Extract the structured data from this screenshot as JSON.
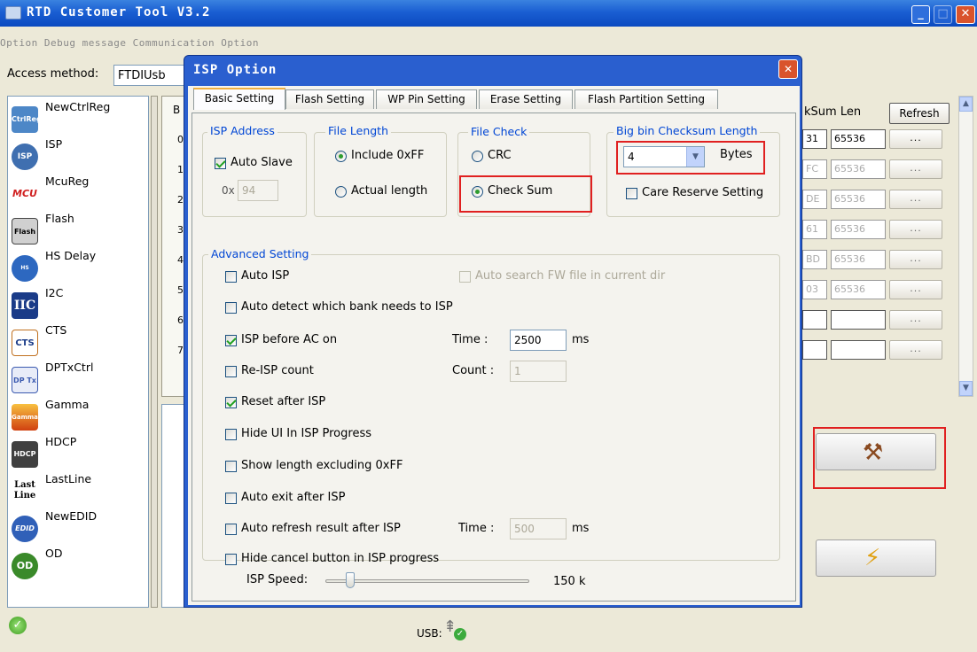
{
  "window": {
    "title": "RTD Customer Tool V3.2"
  },
  "menu": {
    "label": "Option  Debug message  Communication Option"
  },
  "access": {
    "label": "Access method:",
    "value": "FTDIUsb"
  },
  "sidebar": {
    "items": [
      {
        "label": "NewCtrlReg",
        "icon": "ctrlreg-icon",
        "badge": "CtrlReg",
        "color": "#4d87c7"
      },
      {
        "label": "ISP",
        "icon": "isp-icon",
        "badge": "ISP",
        "color": "#3f6fb0"
      },
      {
        "label": "McuReg",
        "icon": "mcu-icon",
        "badge": "MCU",
        "color": "#d02020"
      },
      {
        "label": "Flash",
        "icon": "flash-icon",
        "badge": "Flash",
        "color": "#707070"
      },
      {
        "label": "HS Delay",
        "icon": "hs-delay-icon",
        "badge": "HS Delay",
        "color": "#2d68c0"
      },
      {
        "label": "I2C",
        "icon": "i2c-icon",
        "badge": "IIC",
        "color": "#1a3b88"
      },
      {
        "label": "CTS",
        "icon": "cts-icon",
        "badge": "CTS",
        "color": "#c07020"
      },
      {
        "label": "DPTxCtrl",
        "icon": "dptx-icon",
        "badge": "DP Tx",
        "color": "#3b5ab0"
      },
      {
        "label": "Gamma",
        "icon": "gamma-icon",
        "badge": "Gamma",
        "color": "#e07018"
      },
      {
        "label": "HDCP",
        "icon": "hdcp-icon",
        "badge": "HDCP",
        "color": "#404040"
      },
      {
        "label": "LastLine",
        "icon": "lastline-icon",
        "badge": "Last Line",
        "color": "#000000"
      },
      {
        "label": "NewEDID",
        "icon": "edid-icon",
        "badge": "EDID",
        "color": "#3060b8"
      },
      {
        "label": "OD",
        "icon": "od-icon",
        "badge": "OD",
        "color": "#3a8a2a"
      }
    ]
  },
  "table": {
    "col_b": "B",
    "rows": [
      "0",
      "1",
      "2",
      "3",
      "4",
      "5",
      "6",
      "7"
    ],
    "col_checksum": "kSum Len",
    "refresh": "Refresh",
    "checks": [
      "31",
      "FC",
      "DE",
      "61",
      "BD",
      "03",
      "",
      ""
    ],
    "lens": [
      "65536",
      "65536",
      "65536",
      "65536",
      "65536",
      "65536",
      "",
      ""
    ],
    "dots": "..."
  },
  "status": {
    "usb_label": "USB:"
  },
  "dialog": {
    "title": "ISP Option",
    "tabs": [
      "Basic Setting",
      "Flash Setting",
      "WP Pin Setting",
      "Erase Setting",
      "Flash Partition Setting"
    ],
    "isp_address": {
      "group": "ISP Address",
      "auto_slave": "Auto Slave",
      "prefix": "0x",
      "address": "94"
    },
    "file_length": {
      "group": "File Length",
      "include": "Include 0xFF",
      "actual": "Actual length"
    },
    "file_check": {
      "group": "File Check",
      "crc": "CRC",
      "checksum": "Check Sum"
    },
    "big_bin": {
      "group": "Big bin Checksum Length",
      "value": "4",
      "unit": "Bytes",
      "care": "Care Reserve Setting"
    },
    "advanced": {
      "group": "Advanced Setting",
      "auto_isp": "Auto ISP",
      "auto_search": "Auto search FW file in current dir",
      "auto_detect": "Auto detect which bank needs to ISP",
      "isp_before": "ISP before AC on",
      "time_label": "Time :",
      "time_value": "2500",
      "ms": "ms",
      "reisp": "Re-ISP count",
      "count_label": "Count :",
      "count_value": "1",
      "reset_after": "Reset after ISP",
      "hide_ui": "Hide UI In ISP Progress",
      "show_length": "Show length excluding 0xFF",
      "auto_exit": "Auto exit after ISP",
      "auto_refresh": "Auto refresh result after ISP",
      "refresh_time_label": "Time :",
      "refresh_time": "500",
      "refresh_ms": "ms",
      "hide_cancel": "Hide cancel button in ISP progress"
    },
    "isp_speed": {
      "label": "ISP Speed:",
      "value": "150 k"
    }
  }
}
